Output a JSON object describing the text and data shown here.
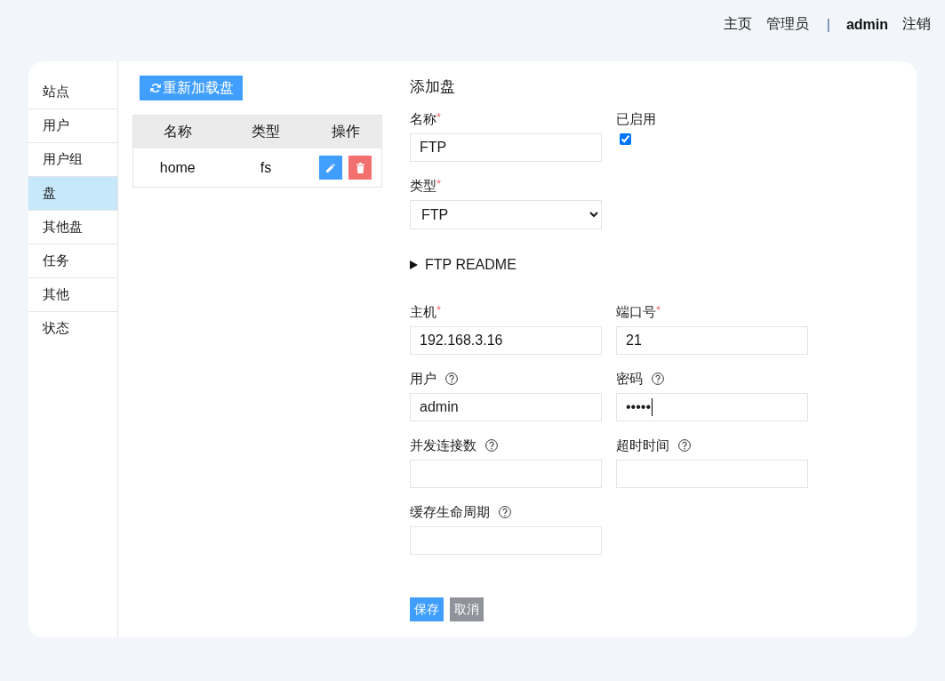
{
  "header": {
    "nav": [
      {
        "kind": "link",
        "label": "主页"
      },
      {
        "kind": "link",
        "label": "管理员"
      },
      {
        "kind": "separator",
        "label": "|"
      },
      {
        "kind": "user",
        "label": "admin"
      },
      {
        "kind": "logout",
        "label": "注销"
      }
    ]
  },
  "sidebar": {
    "items": [
      {
        "label": "站点",
        "selected": false
      },
      {
        "label": "用户",
        "selected": false
      },
      {
        "label": "用户组",
        "selected": false
      },
      {
        "label": "盘",
        "selected": true
      },
      {
        "label": "其他盘",
        "selected": false
      },
      {
        "label": "任务",
        "selected": false
      },
      {
        "label": "其他",
        "selected": false
      },
      {
        "label": "状态",
        "selected": false
      }
    ]
  },
  "disk_list": {
    "reload_button": "重新加载盘",
    "table": {
      "columns": [
        "名称",
        "类型",
        "操作"
      ],
      "rows": [
        {
          "cells": [
            "home",
            "fs"
          ],
          "actions": [
            {
              "kind": "edit"
            },
            {
              "kind": "delete"
            }
          ]
        }
      ]
    }
  },
  "form": {
    "title": "添加盘",
    "rows": [
      {
        "kind": "fields",
        "fields": [
          {
            "kind": "text",
            "label": "名称",
            "required_mark": "*",
            "value": "FTP"
          },
          {
            "kind": "checkbox",
            "label": "已启用",
            "checked": true
          }
        ]
      },
      {
        "kind": "fields",
        "fields": [
          {
            "kind": "select",
            "label": "类型",
            "required_mark": "*",
            "value": "FTP"
          }
        ]
      },
      {
        "kind": "disclosure",
        "label": "FTP README",
        "expanded": false
      },
      {
        "kind": "fields",
        "fields": [
          {
            "kind": "text",
            "label": "主机",
            "required_mark": "*",
            "value": "192.168.3.16"
          },
          {
            "kind": "text",
            "label": "端口号",
            "required_mark": "*",
            "value": "21"
          }
        ]
      },
      {
        "kind": "fields",
        "fields": [
          {
            "kind": "text",
            "label": "用户",
            "help": true,
            "value": "admin"
          },
          {
            "kind": "password",
            "label": "密码",
            "help": true,
            "value": "•••••",
            "focused": true
          }
        ]
      },
      {
        "kind": "fields",
        "fields": [
          {
            "kind": "text",
            "label": "并发连接数",
            "help": true
          },
          {
            "kind": "text",
            "label": "超时时间",
            "help": true
          }
        ]
      },
      {
        "kind": "fields",
        "fields": [
          {
            "kind": "text",
            "label": "缓存生命周期",
            "help": true
          }
        ]
      }
    ],
    "buttons": [
      {
        "kind": "save",
        "label": "保存"
      },
      {
        "kind": "cancel",
        "label": "取消"
      }
    ]
  }
}
